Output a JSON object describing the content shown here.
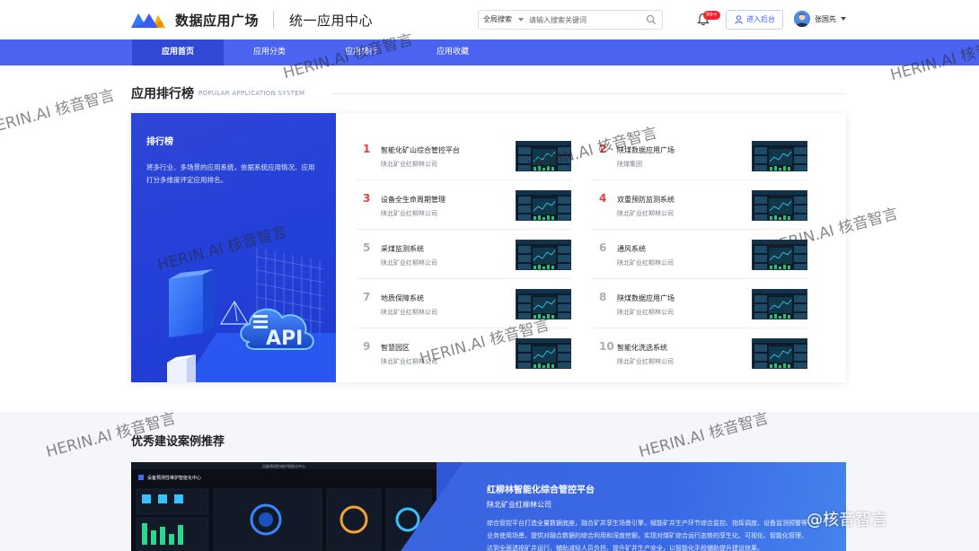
{
  "header": {
    "brand": "数据应用广场",
    "subbrand": "统一应用中心",
    "search_scope": "全局搜索",
    "search_placeholder": "请输入搜索关键词",
    "notification_badge": "99+",
    "admin_button": "进入后台",
    "username": "张国先"
  },
  "nav": {
    "items": [
      "应用首页",
      "应用分类",
      "应用排行",
      "应用收藏"
    ],
    "active": "应用首页"
  },
  "ranking": {
    "title": "应用排行榜",
    "subtitle": "POPULAR APPLICATION SYSTEM",
    "panel_title": "排行榜",
    "panel_desc": "将多行业、多场景的应用系统，依据系统应用情况、应用打分多维度评定应用排名。",
    "api_label": "API",
    "items": [
      {
        "rank": "1",
        "name": "智能化矿山综合管控平台",
        "org": "陕北矿业红柳林公司"
      },
      {
        "rank": "2",
        "name": "陕煤数据应用广场",
        "org": "陕煤集团"
      },
      {
        "rank": "3",
        "name": "设备全生命周期管理",
        "org": "陕北矿业红柳林公司"
      },
      {
        "rank": "4",
        "name": "双重预防监测系统",
        "org": "陕北矿业红柳林公司"
      },
      {
        "rank": "5",
        "name": "采煤监测系统",
        "org": "陕北矿业红柳林公司"
      },
      {
        "rank": "6",
        "name": "通风系统",
        "org": "陕北矿业红柳林公司"
      },
      {
        "rank": "7",
        "name": "地质保障系统",
        "org": "陕北矿业红柳林公司"
      },
      {
        "rank": "8",
        "name": "陕煤数据应用广场",
        "org": "陕北矿业红柳林公司"
      },
      {
        "rank": "9",
        "name": "智慧园区",
        "org": "陕北矿业红柳林公司"
      },
      {
        "rank": "10",
        "name": "智能化洗选系统",
        "org": "陕北矿业红柳林公司"
      }
    ]
  },
  "cases": {
    "title": "优秀建设案例推荐",
    "card": {
      "title": "红柳林智能化综合管控平台",
      "org": "陕北矿业红柳林公司",
      "desc": "综合管控平台打造全量数据底座，融合矿井孪生场景引擎，赋能矿井生产环节综合监控、指挥调度、设备监测预警等业务使用场景，提供对融合数据的综合利用和深度挖掘，实现对煤矿综合运行态势的孪生化、可视化、智能化管理，达到全面透视矿井运行、辅助减轻人员负担、提升矿井生产安全，以智能化手段辅助提升建设效果。",
      "screen_title": "设备预测性维护智能化中心"
    }
  },
  "watermark": "HERIN.AI 核音智言",
  "corner_logo": "@核音智言",
  "colors": {
    "primary": "#4a63f0",
    "nav_active": "#3049d6",
    "rank_top": "#ef3b3b"
  }
}
